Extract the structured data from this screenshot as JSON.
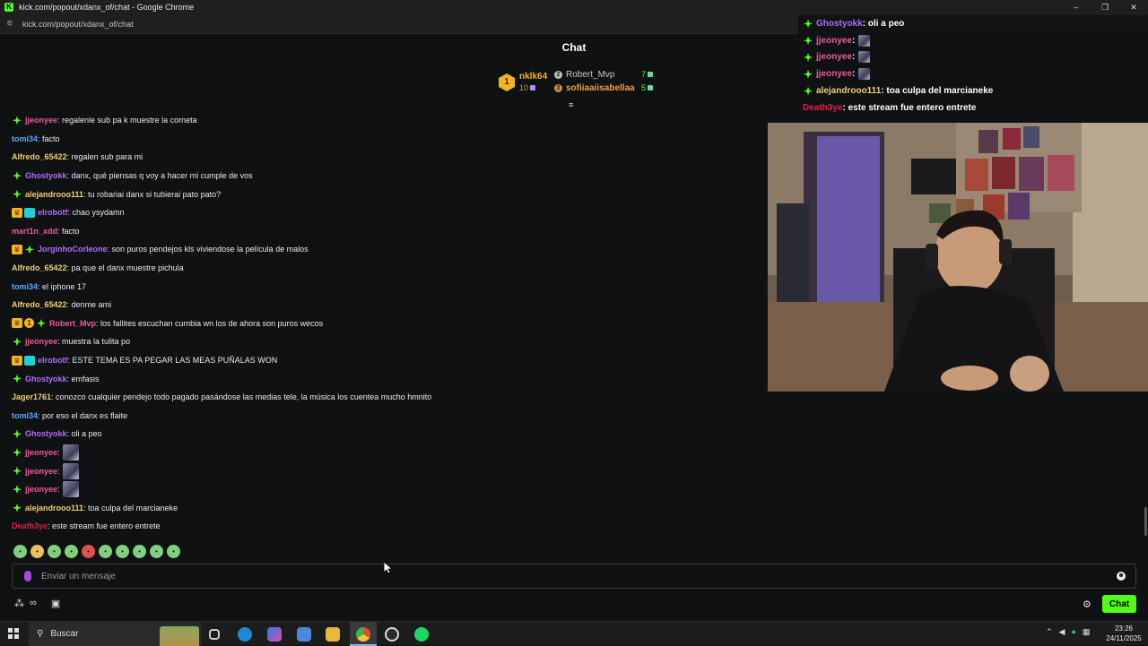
{
  "window": {
    "title": "kick.com/popout/xdanx_of/chat - Google Chrome",
    "url": "kick.com/popout/xdanx_of/chat",
    "win_minimize": "–",
    "win_restore": "❐",
    "win_close": "✕",
    "favicon_letter": "K"
  },
  "chat": {
    "header": "Chat",
    "leaderboard": {
      "top": {
        "rank": "1",
        "name": "nklk64",
        "count": "10"
      },
      "others": [
        {
          "name": "Robert_Mvp",
          "count": "7",
          "color": "#c8c8c8",
          "rank_color": "#c0c0c0"
        },
        {
          "name": "sofiiaaiisabellaa",
          "count": "5",
          "color": "#f0a040",
          "rank_color": "#d88a3a"
        }
      ]
    },
    "messages": [
      {
        "badges": [
          "sub"
        ],
        "user": "jjeonyee",
        "color": "#f05a9a",
        "text": ": regalenle sub pa k muestre la corneta"
      },
      {
        "badges": [],
        "user": "tomi34",
        "color": "#5fa8ff",
        "text": ": facto"
      },
      {
        "badges": [],
        "user": "Alfredo_65422",
        "color": "#f0d070",
        "text": ": regalen sub para mi"
      },
      {
        "badges": [
          "sub"
        ],
        "user": "Ghostyokk",
        "color": "#b36bff",
        "text": ": danx, qué piensas q voy a hacer mi cumple de vos"
      },
      {
        "badges": [
          "sub"
        ],
        "user": "alejandrooo111",
        "color": "#f0d070",
        "text": ": tu robariai danx si tubierai pato pato?"
      },
      {
        "badges": [
          "crown",
          "bot"
        ],
        "user": "elrobotf",
        "color": "#b36bff",
        "text": ": chao ysydamn"
      },
      {
        "badges": [],
        "user": "mart1n_xdd",
        "color": "#f05a9a",
        "text": ": facto"
      },
      {
        "badges": [
          "crown",
          "sub"
        ],
        "user": "JorginhoCorleone",
        "color": "#b36bff",
        "text": ": son puros pendejos kls viviendose la película de malos"
      },
      {
        "badges": [],
        "user": "Alfredo_65422",
        "color": "#f0d070",
        "text": ": pa que el danx muestre pichula"
      },
      {
        "badges": [],
        "user": "tomi34",
        "color": "#5fa8ff",
        "text": ": el iphone 17"
      },
      {
        "badges": [],
        "user": "Alfredo_65422",
        "color": "#f0d070",
        "text": ": denme ami"
      },
      {
        "badges": [
          "crown",
          "one",
          "sub"
        ],
        "user": "Robert_Mvp",
        "color": "#f05a9a",
        "text": ": los fallites escuchan cumbia wn los de ahora son puros wecos"
      },
      {
        "badges": [
          "sub"
        ],
        "user": "jjeonyee",
        "color": "#f05a9a",
        "text": ": muestra la tulita po"
      },
      {
        "badges": [
          "crown",
          "bot"
        ],
        "user": "elrobotf",
        "color": "#b36bff",
        "text": ": ESTE TEMA ES PA PEGAR LAS MEAS PUÑALAS WON"
      },
      {
        "badges": [
          "sub"
        ],
        "user": "Ghostyokk",
        "color": "#b36bff",
        "text": ": emfasis"
      },
      {
        "badges": [],
        "user": "Jager1761",
        "color": "#f0d070",
        "text": ": conozco cualquier pendejo todo pagado pasándose las medias tele, la música los cuentea mucho hmnito"
      },
      {
        "badges": [],
        "user": "tomi34",
        "color": "#5fa8ff",
        "text": ": por eso el danx es flaite"
      },
      {
        "badges": [
          "sub"
        ],
        "user": "Ghostyokk",
        "color": "#b36bff",
        "text": ": oli a peo"
      },
      {
        "badges": [
          "sub"
        ],
        "user": "jjeonyee",
        "color": "#f05a9a",
        "text": ":",
        "emote": true
      },
      {
        "badges": [
          "sub"
        ],
        "user": "jjeonyee",
        "color": "#f05a9a",
        "text": ":",
        "emote": true
      },
      {
        "badges": [
          "sub"
        ],
        "user": "jjeonyee",
        "color": "#f05a9a",
        "text": ":",
        "emote": true
      },
      {
        "badges": [
          "sub"
        ],
        "user": "alejandrooo111",
        "color": "#f0d070",
        "text": ": toa culpa del marcianeke"
      },
      {
        "badges": [],
        "user": "Death3ye",
        "color": "#e0204a",
        "text": ": este stream fue entero entrete"
      }
    ],
    "emote_bar": [
      "green",
      "yellow",
      "green",
      "green",
      "red",
      "green",
      "green",
      "green",
      "green",
      "green"
    ],
    "input": {
      "placeholder": "Enviar un mensaje"
    },
    "send_button": "Chat",
    "bottom_left_icons": [
      "⁂",
      "∞",
      "▣"
    ],
    "gear_icon": "⚙",
    "expand_icon": "≡"
  },
  "overlay_messages": [
    {
      "user": "Ghostyokk",
      "color": "#b36bff",
      "text": ": oli a peo"
    },
    {
      "user": "jjeonyee",
      "color": "#f05a9a",
      "text": " :",
      "emote": true
    },
    {
      "user": "jjeonyee",
      "color": "#f05a9a",
      "text": " :",
      "emote": true
    },
    {
      "user": "jjeonyee",
      "color": "#f05a9a",
      "text": " :",
      "emote": true
    },
    {
      "user": "alejandrooo111",
      "color": "#f0d070",
      "text": ": toa culpa del marcianeke"
    },
    {
      "user": "Death3ye",
      "color": "#e0204a",
      "text": ": este stream fue entero entrete",
      "no_badge": true
    }
  ],
  "taskbar": {
    "search_label": "Buscar",
    "clock_time": "23:26",
    "clock_date": "24/11/2025"
  },
  "colors": {
    "accent": "#53fc18",
    "background": "#0f1113"
  }
}
